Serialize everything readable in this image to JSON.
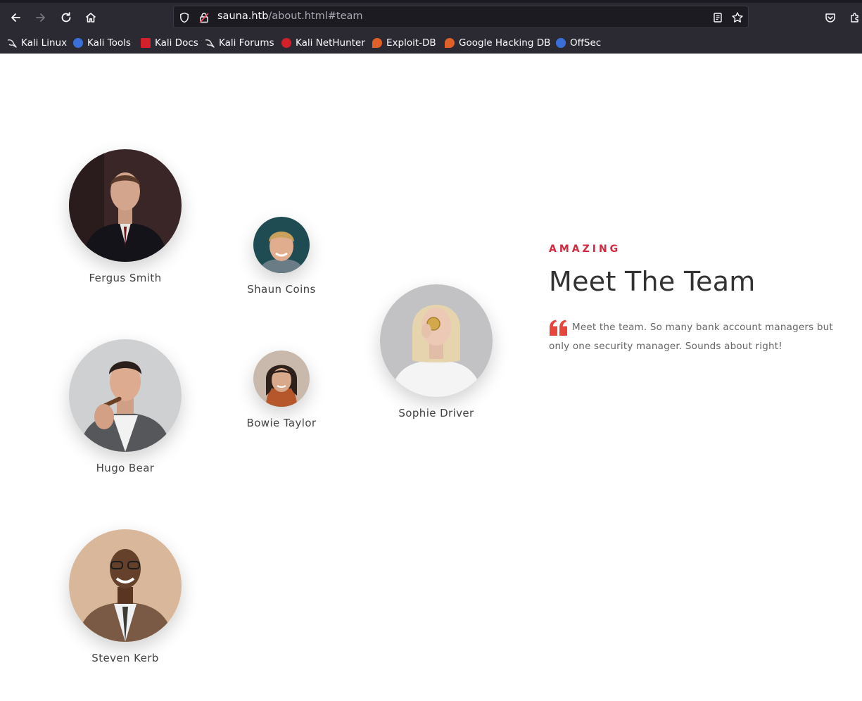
{
  "browser": {
    "url_host": "sauna.htb",
    "url_path": "/about.html#team",
    "bookmarks": [
      {
        "label": "Kali Linux",
        "icon": "kali-dragon-icon",
        "color": "#111111"
      },
      {
        "label": "Kali Tools",
        "icon": "kali-tools-icon",
        "color": "#3a6fd8"
      },
      {
        "label": "Kali Docs",
        "icon": "kali-docs-icon",
        "color": "#d4202b"
      },
      {
        "label": "Kali Forums",
        "icon": "kali-forums-icon",
        "color": "#111111"
      },
      {
        "label": "Kali NetHunter",
        "icon": "kali-nethunter-icon",
        "color": "#d4202b"
      },
      {
        "label": "Exploit-DB",
        "icon": "exploit-db-icon",
        "color": "#e0602a"
      },
      {
        "label": "Google Hacking DB",
        "icon": "ghdb-icon",
        "color": "#e0602a"
      },
      {
        "label": "OffSec",
        "icon": "offsec-icon",
        "color": "#3a6fd8"
      }
    ]
  },
  "team": {
    "eyebrow": "AMAZING",
    "heading": "Meet The Team",
    "quote": "Meet the team. So many bank account managers but only one security manager. Sounds about right!",
    "accent_color": "#d7263d",
    "members": [
      {
        "name": "Fergus Smith"
      },
      {
        "name": "Shaun Coins"
      },
      {
        "name": "Hugo Bear"
      },
      {
        "name": "Bowie Taylor"
      },
      {
        "name": "Sophie Driver"
      },
      {
        "name": "Steven Kerb"
      }
    ]
  }
}
